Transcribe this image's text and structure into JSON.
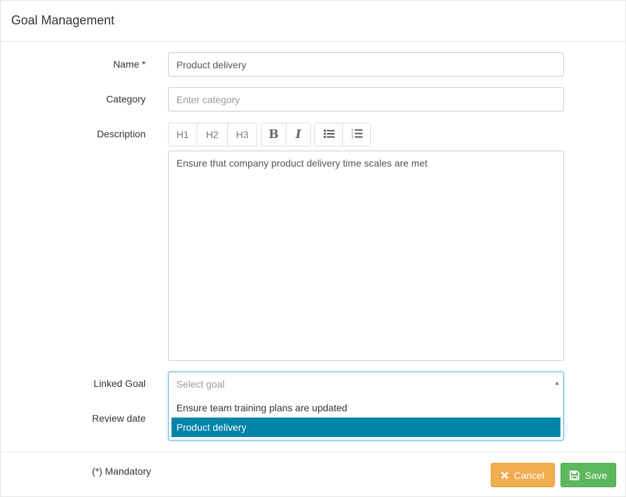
{
  "header": {
    "title": "Goal Management"
  },
  "form": {
    "name": {
      "label": "Name *",
      "value": "Product delivery"
    },
    "category": {
      "label": "Category",
      "placeholder": "Enter category"
    },
    "description": {
      "label": "Description",
      "toolbar": {
        "h1": "H1",
        "h2": "H2",
        "h3": "H3",
        "bold": "B",
        "italic": "I",
        "bullet_icon": "bulleted-list-icon",
        "numbered_icon": "numbered-list-icon"
      },
      "value": "Ensure that company product delivery time scales are met"
    },
    "linked_goal": {
      "label": "Linked Goal",
      "placeholder": "Select goal",
      "options": [
        "Ensure team training plans are updated",
        "Product delivery"
      ],
      "highlighted": "Product delivery"
    },
    "review_date": {
      "label": "Review date"
    }
  },
  "footer": {
    "mandatory_note": "(*) Mandatory",
    "cancel_label": "Cancel",
    "save_label": "Save"
  },
  "colors": {
    "cancel": "#f0ad4e",
    "save": "#5cb85c",
    "highlight": "#0084a8",
    "focus_border": "#66afe9"
  }
}
